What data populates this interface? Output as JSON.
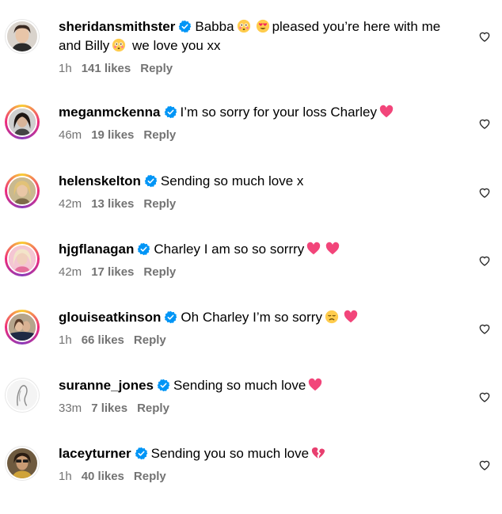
{
  "comments": [
    {
      "username": "sheridansmithster",
      "text_parts": [
        "Babba",
        "pleased you’re here with me and Billy",
        "we love you xx"
      ],
      "emojis": [
        "flushed-face-emoji",
        "heart-eyes-emoji",
        "flushed-face-emoji"
      ],
      "time": "1h",
      "likes": "141 likes",
      "reply": "Reply",
      "has_story_ring": false
    },
    {
      "username": "meganmckenna",
      "text": "I’m so sorry for your loss Charley",
      "emojis": [
        "pink-heart-emoji"
      ],
      "time": "46m",
      "likes": "19 likes",
      "reply": "Reply",
      "has_story_ring": true
    },
    {
      "username": "helenskelton",
      "text": "Sending so much love x",
      "emojis": [],
      "time": "42m",
      "likes": "13 likes",
      "reply": "Reply",
      "has_story_ring": true
    },
    {
      "username": "hjgflanagan",
      "text": "Charley I am so so sorrry",
      "emojis": [
        "pink-heart-emoji",
        "pink-heart-emoji"
      ],
      "time": "42m",
      "likes": "17 likes",
      "reply": "Reply",
      "has_story_ring": true
    },
    {
      "username": "glouiseatkinson",
      "text": "Oh Charley I’m so sorry",
      "emojis": [
        "sad-face-emoji",
        "pink-heart-emoji"
      ],
      "time": "1h",
      "likes": "66 likes",
      "reply": "Reply",
      "has_story_ring": true
    },
    {
      "username": "suranne_jones",
      "text": "Sending so much love",
      "emojis": [
        "pink-heart-emoji"
      ],
      "time": "33m",
      "likes": "7 likes",
      "reply": "Reply",
      "has_story_ring": false
    },
    {
      "username": "laceyturner",
      "text": "Sending you so much love",
      "emojis": [
        "broken-heart-emoji"
      ],
      "time": "1h",
      "likes": "40 likes",
      "reply": "Reply",
      "has_story_ring": false
    }
  ],
  "colors": {
    "verified": "#0095f6",
    "meta_text": "#737373",
    "heart_emoji": "#f2457a"
  },
  "icons": {
    "verified": "verified-badge-icon",
    "like": "heart-outline-icon"
  }
}
